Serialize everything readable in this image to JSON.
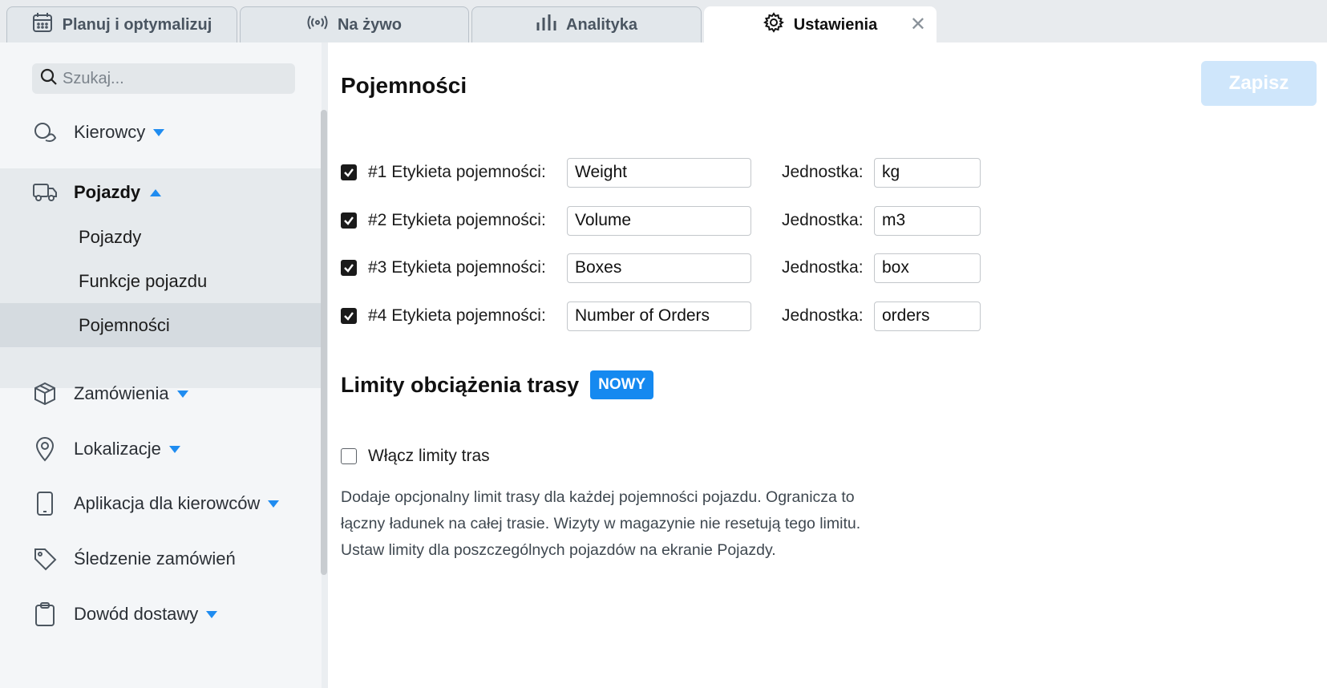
{
  "tabs": [
    {
      "label": "Planuj i optymalizuj",
      "icon": "calendar-icon"
    },
    {
      "label": "Na żywo",
      "icon": "broadcast-icon"
    },
    {
      "label": "Analityka",
      "icon": "bar-chart-icon"
    },
    {
      "label": "Ustawienia",
      "icon": "gear-icon",
      "active": true,
      "close": "✕"
    }
  ],
  "sidebar": {
    "search_placeholder": "Szukaj...",
    "items": [
      {
        "label": "Kierowcy",
        "icon": "driver-icon",
        "caret": "down"
      },
      {
        "label": "Pojazdy",
        "icon": "truck-icon",
        "caret": "up",
        "expanded": true,
        "children": [
          {
            "label": "Pojazdy"
          },
          {
            "label": "Funkcje pojazdu"
          },
          {
            "label": "Pojemności",
            "selected": true
          }
        ]
      },
      {
        "label": "Zamówienia",
        "icon": "package-icon",
        "caret": "down"
      },
      {
        "label": "Lokalizacje",
        "icon": "map-pin-icon",
        "caret": "down"
      },
      {
        "label": "Aplikacja dla kierowców",
        "icon": "phone-icon",
        "caret": "down"
      },
      {
        "label": "Śledzenie zamówień",
        "icon": "tag-icon"
      },
      {
        "label": "Dowód dostawy",
        "icon": "clipboard-icon",
        "caret": "down"
      }
    ]
  },
  "main": {
    "title": "Pojemności",
    "save_label": "Zapisz",
    "capacities": [
      {
        "label": "#1 Etykieta pojemności:",
        "value": "Weight",
        "unit_label": "Jednostka:",
        "unit": "kg",
        "checked": true
      },
      {
        "label": "#2 Etykieta pojemności:",
        "value": "Volume",
        "unit_label": "Jednostka:",
        "unit": "m3",
        "checked": true
      },
      {
        "label": "#3 Etykieta pojemności:",
        "value": "Boxes",
        "unit_label": "Jednostka:",
        "unit": "box",
        "checked": true
      },
      {
        "label": "#4 Etykieta pojemności:",
        "value": "Number of Orders",
        "unit_label": "Jednostka:",
        "unit": "orders",
        "checked": true
      }
    ],
    "route_limits": {
      "title": "Limity obciążenia trasy",
      "badge": "NOWY",
      "enable_label": "Włącz limity tras",
      "enabled": false,
      "description_lines": [
        "Dodaje opcjonalny limit trasy dla każdej pojemności pojazdu. Ogranicza to",
        "łączny ładunek na całej trasie. Wizyty w magazynie nie resetują tego limitu.",
        "Ustaw limity dla poszczególnych pojazdów na ekranie Pojazdy."
      ]
    }
  },
  "colors": {
    "accent": "#1f8cf0",
    "badge": "#1589f0",
    "save_disabled": "#cfe6fb",
    "sidebar_bg": "#f4f6f8",
    "selected_bg": "#d5dbe0"
  }
}
